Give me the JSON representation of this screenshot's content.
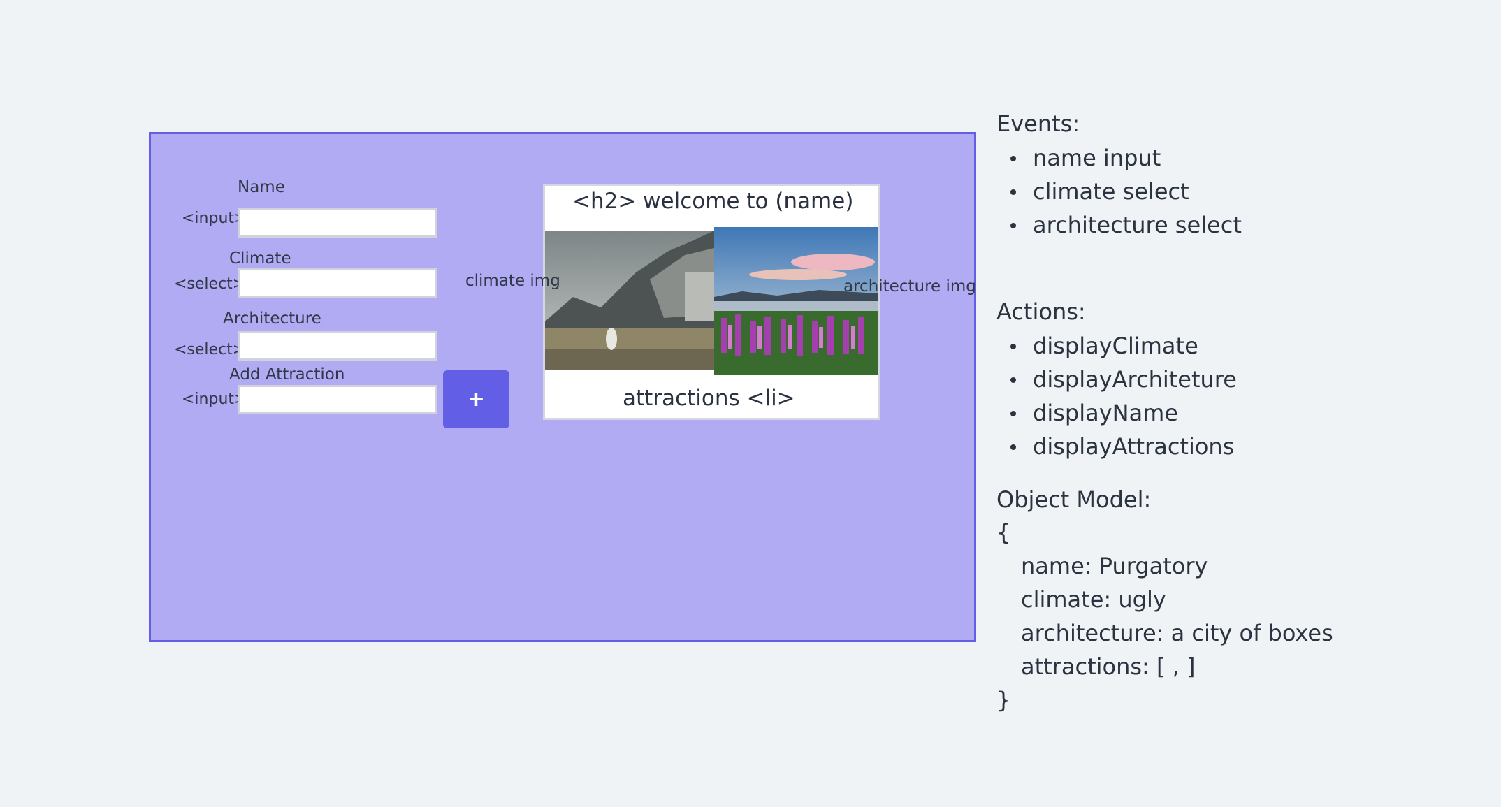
{
  "form": {
    "name_label": "Name",
    "name_tag": "<input>",
    "climate_label": "Climate",
    "climate_tag": "<select>",
    "architecture_label": "Architecture",
    "architecture_tag": "<select>",
    "attraction_label": "Add Attraction",
    "attraction_tag": "<input>",
    "add_button": "+"
  },
  "preview": {
    "title": "<h2> welcome to (name)",
    "climate_img_label": "climate img",
    "architecture_img_label": "architecture img",
    "attractions": "attractions <li>"
  },
  "events": {
    "title": "Events:",
    "items": [
      "name input",
      "climate select",
      "architecture select"
    ]
  },
  "actions": {
    "title": "Actions:",
    "items": [
      "displayClimate",
      "displayArchiteture",
      "displayName",
      "displayAttractions"
    ]
  },
  "object_model": {
    "title": "Object Model:",
    "open": "{",
    "lines": [
      "name: Purgatory",
      "climate: ugly",
      "architecture: a city of boxes",
      "attractions: [ , ]"
    ],
    "close": "}"
  },
  "colors": {
    "background": "#eff3f6",
    "frame_fill": "#b1abf4",
    "frame_border": "#645ee4",
    "button": "#625ee6"
  }
}
